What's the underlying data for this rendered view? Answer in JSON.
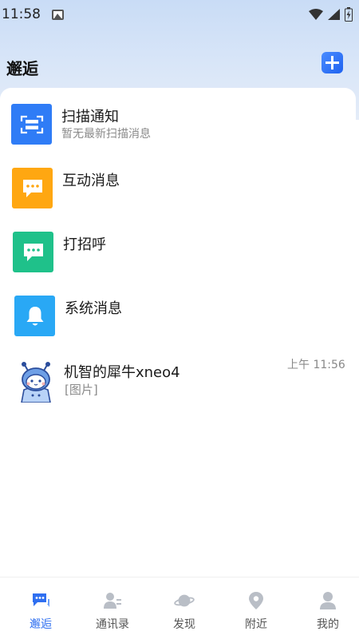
{
  "status_bar": {
    "time": "11:58"
  },
  "header": {
    "title": "邂逅"
  },
  "messages": [
    {
      "title": "扫描通知",
      "subtitle": "暂无最新扫描消息",
      "icon": "scan-icon",
      "color": "#2f7cf6"
    },
    {
      "title": "互动消息",
      "icon": "chat-bubble-icon",
      "color": "#ffa711"
    },
    {
      "title": "打招呼",
      "icon": "greeting-icon",
      "color": "#1fc18a"
    },
    {
      "title": "系统消息",
      "icon": "bell-icon",
      "color": "#29a8f5"
    },
    {
      "title": "机智的犀牛xneo4",
      "subtitle": "[图片]",
      "time": "上午 11:56",
      "icon": "avatar-robot"
    }
  ],
  "tabbar": {
    "tabs": [
      {
        "label": "邂逅",
        "icon": "chat-icon",
        "active": true
      },
      {
        "label": "通讯录",
        "icon": "contacts-icon"
      },
      {
        "label": "发现",
        "icon": "planet-icon"
      },
      {
        "label": "附近",
        "icon": "location-pin-icon"
      },
      {
        "label": "我的",
        "icon": "person-icon"
      }
    ]
  },
  "colors": {
    "accent": "#2f6ff0",
    "tab_inactive": "#b9bec6"
  }
}
